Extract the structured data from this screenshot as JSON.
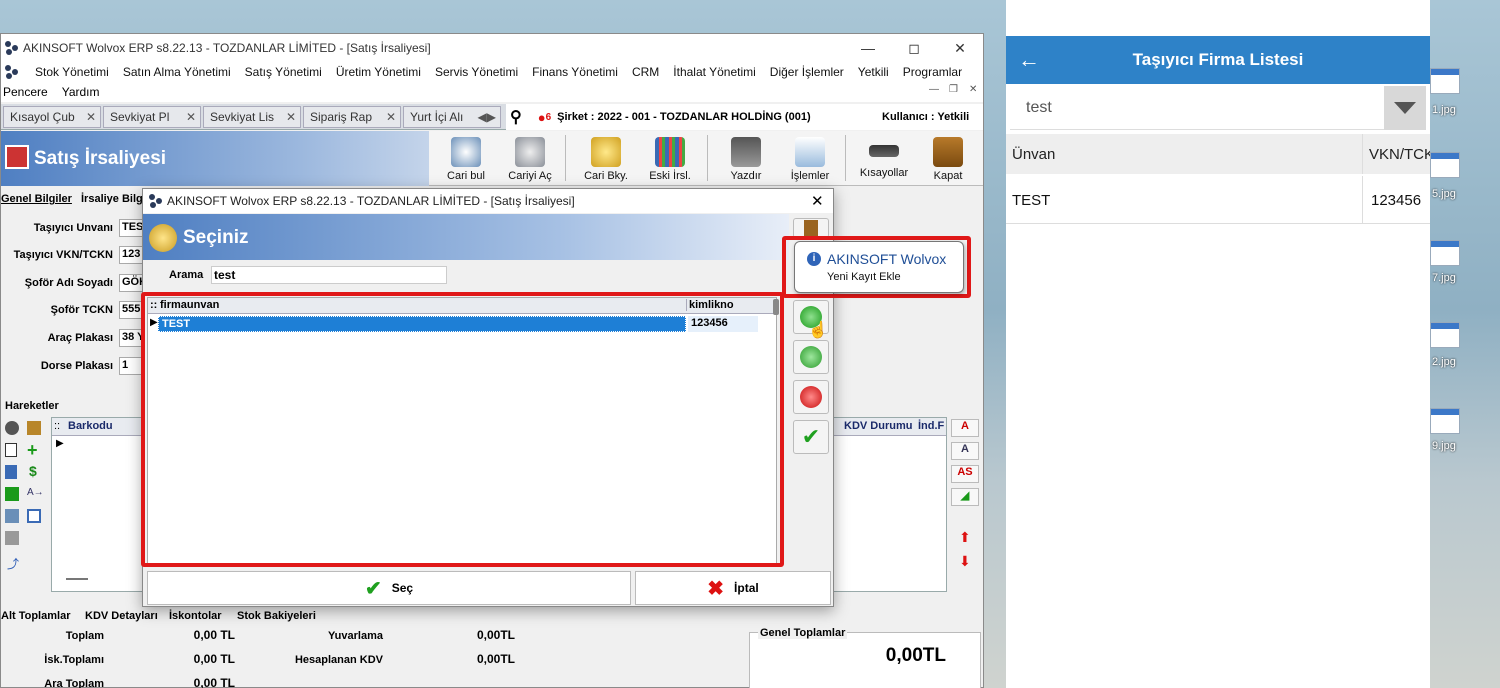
{
  "main_window": {
    "title": "AKINSOFT Wolvox ERP s8.22.13 - TOZDANLAR LİMİTED - [Satış İrsaliyesi]",
    "menu": [
      "Stok Yönetimi",
      "Satın Alma Yönetimi",
      "Satış Yönetimi",
      "Üretim Yönetimi",
      "Servis Yönetimi",
      "Finans Yönetimi",
      "CRM",
      "İthalat Yönetimi",
      "Diğer İşlemler",
      "Yetkili",
      "Programlar"
    ],
    "menu2": [
      "Pencere",
      "Yardım"
    ],
    "tabs": [
      "Kısayol Çub",
      "Sevkiyat Pl",
      "Sevkiyat Lis",
      "Sipariş Rap",
      "Yurt İçi Alı"
    ],
    "notification_count": "6",
    "company": "Şirket : 2022 - 001 - TOZDANLAR HOLDİNG (001)",
    "user": "Kullanıcı : Yetkili",
    "page_title": "Satış İrsaliyesi",
    "toolbar": [
      "Cari bul",
      "Cariyi Aç",
      "Cari Bky.",
      "Eski İrsl.",
      "Yazdır",
      "İşlemler",
      "Kısayollar",
      "Kapat"
    ],
    "subtabs": [
      "Genel Bilgiler",
      "İrsaliye Bilg"
    ],
    "fields": [
      {
        "label": "Taşıyıcı Unvanı",
        "value": "TES"
      },
      {
        "label": "Taşıyıcı VKN/TCKN",
        "value": "123"
      },
      {
        "label": "Şoför Adı Soyadı",
        "value": "GÖK"
      },
      {
        "label": "Şoför TCKN",
        "value": "555"
      },
      {
        "label": "Araç Plakası",
        "value": "38 Y"
      },
      {
        "label": "Dorse Plakası",
        "value": "1"
      }
    ],
    "hareketler": "Hareketler",
    "grid_headers": {
      "barkod": "Barkodu",
      "kdv": "KDV Durumu",
      "ind": "İnd.F"
    },
    "right_tools": [
      "A",
      "A",
      "AS"
    ],
    "bottom_tabs": [
      "Alt Toplamlar",
      "KDV Detayları",
      "İskontolar",
      "Stok Bakiyeleri"
    ],
    "totals": {
      "toplam_label": "Toplam",
      "toplam": "0,00 TL",
      "isk_label": "İsk.Toplamı",
      "isk": "0,00 TL",
      "ara_label": "Ara Toplam",
      "ara": "0,00 TL",
      "yuv_label": "Yuvarlama",
      "yuv": "0,00TL",
      "hkdv_label": "Hesaplanan KDV",
      "hkdv": "0,00TL",
      "genel_label": "Genel Toplamlar",
      "genel": "0,00TL"
    }
  },
  "dialog": {
    "title": "AKINSOFT Wolvox ERP s8.22.13 - TOZDANLAR LİMİTED - [Satış İrsaliyesi]",
    "header": "Seçiniz",
    "search_label": "Arama",
    "search_value": "test",
    "columns": [
      "firmaunvan",
      "kimlikno"
    ],
    "rows": [
      {
        "firmaunvan": "TEST",
        "kimlikno": "123456"
      }
    ],
    "ok": "Seç",
    "cancel": "İptal"
  },
  "tooltip": {
    "title": "AKINSOFT Wolvox",
    "subtitle": "Yeni Kayıt Ekle"
  },
  "mobile": {
    "title": "Taşıyıcı Firma Listesi",
    "search_value": "test",
    "columns": [
      "Ünvan",
      "VKN/TCK"
    ],
    "rows": [
      {
        "unvan": "TEST",
        "vkn": "123456"
      }
    ]
  },
  "desktop_icons": [
    "1.jpg",
    "5.jpg",
    "7.jpg",
    "2.jpg",
    "9.jpg"
  ],
  "colors": {
    "accent": "#2e82c8",
    "highlight": "#e01818",
    "selection": "#1e7fd6"
  }
}
